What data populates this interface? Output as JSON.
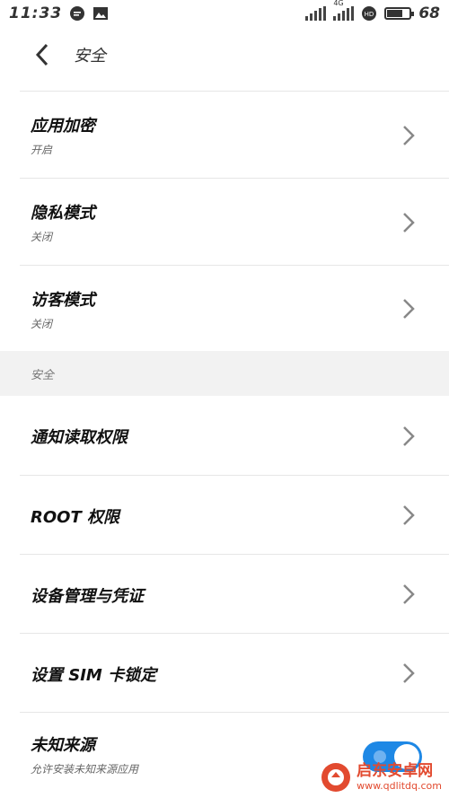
{
  "status_bar": {
    "time": "11:33",
    "network_label": "4G",
    "battery_level": 68,
    "battery_text": "68"
  },
  "header": {
    "title": "安全"
  },
  "items_top": [
    {
      "title": "应用加密",
      "subtitle": "开启"
    },
    {
      "title": "隐私模式",
      "subtitle": "关闭"
    },
    {
      "title": "访客模式",
      "subtitle": "关闭"
    }
  ],
  "section": {
    "title": "安全"
  },
  "items_security": [
    {
      "title": "通知读取权限"
    },
    {
      "title": "ROOT 权限"
    },
    {
      "title": "设备管理与凭证"
    },
    {
      "title": "设置 SIM 卡锁定"
    }
  ],
  "unknown_sources": {
    "title": "未知来源",
    "subtitle": "允许安装未知来源应用",
    "enabled": true
  },
  "watermark": {
    "name": "启东安卓网",
    "url": "www.qdlitdq.com"
  },
  "colors": {
    "toggle_on": "#1e88e5",
    "section_bg": "#f2f2f2",
    "watermark": "#e24a2f"
  }
}
